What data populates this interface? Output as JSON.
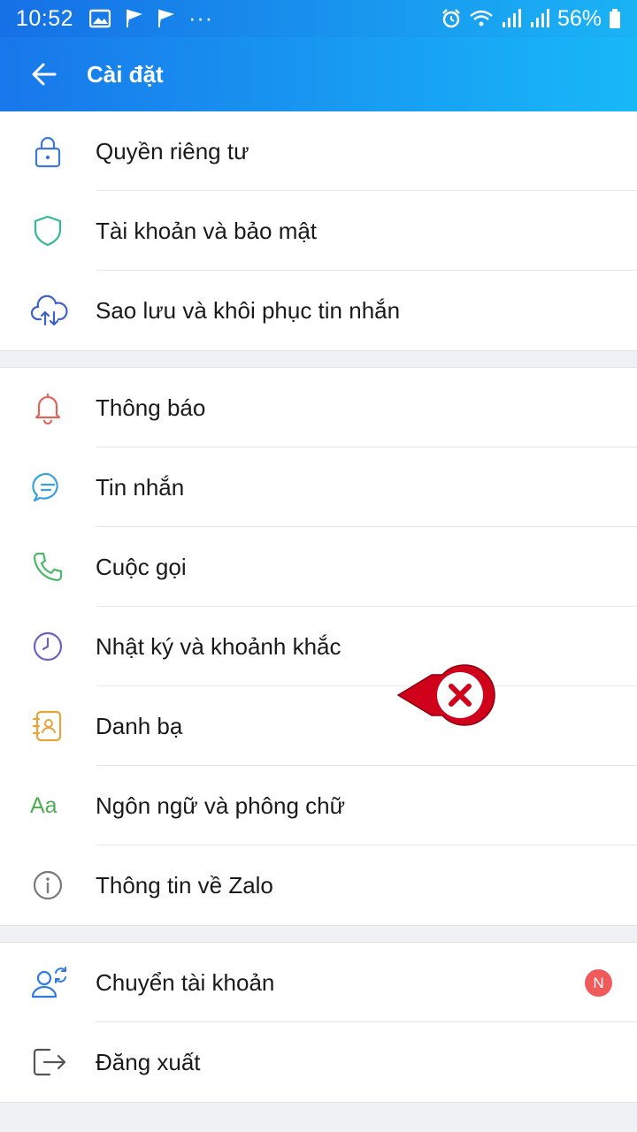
{
  "status_bar": {
    "time": "10:52",
    "more": "···",
    "battery": "56%"
  },
  "app_bar": {
    "title": "Cài đặt"
  },
  "sections": [
    {
      "items": [
        {
          "label": "Quyền riêng tư"
        },
        {
          "label": "Tài khoản và bảo mật"
        },
        {
          "label": "Sao lưu và khôi phục tin nhắn"
        }
      ]
    },
    {
      "items": [
        {
          "label": "Thông báo"
        },
        {
          "label": "Tin nhắn"
        },
        {
          "label": "Cuộc gọi"
        },
        {
          "label": "Nhật ký và khoảnh khắc"
        },
        {
          "label": "Danh bạ"
        },
        {
          "label": "Ngôn ngữ và phông chữ",
          "icon_text": "Aa"
        },
        {
          "label": "Thông tin về Zalo"
        }
      ]
    },
    {
      "items": [
        {
          "label": "Chuyển tài khoản",
          "badge": "N"
        },
        {
          "label": "Đăng xuất"
        }
      ]
    }
  ],
  "colors": {
    "header_start": "#1670e6",
    "header_end": "#1ab3f5",
    "badge": "#ef5a5a",
    "marker": "#d0021b"
  }
}
